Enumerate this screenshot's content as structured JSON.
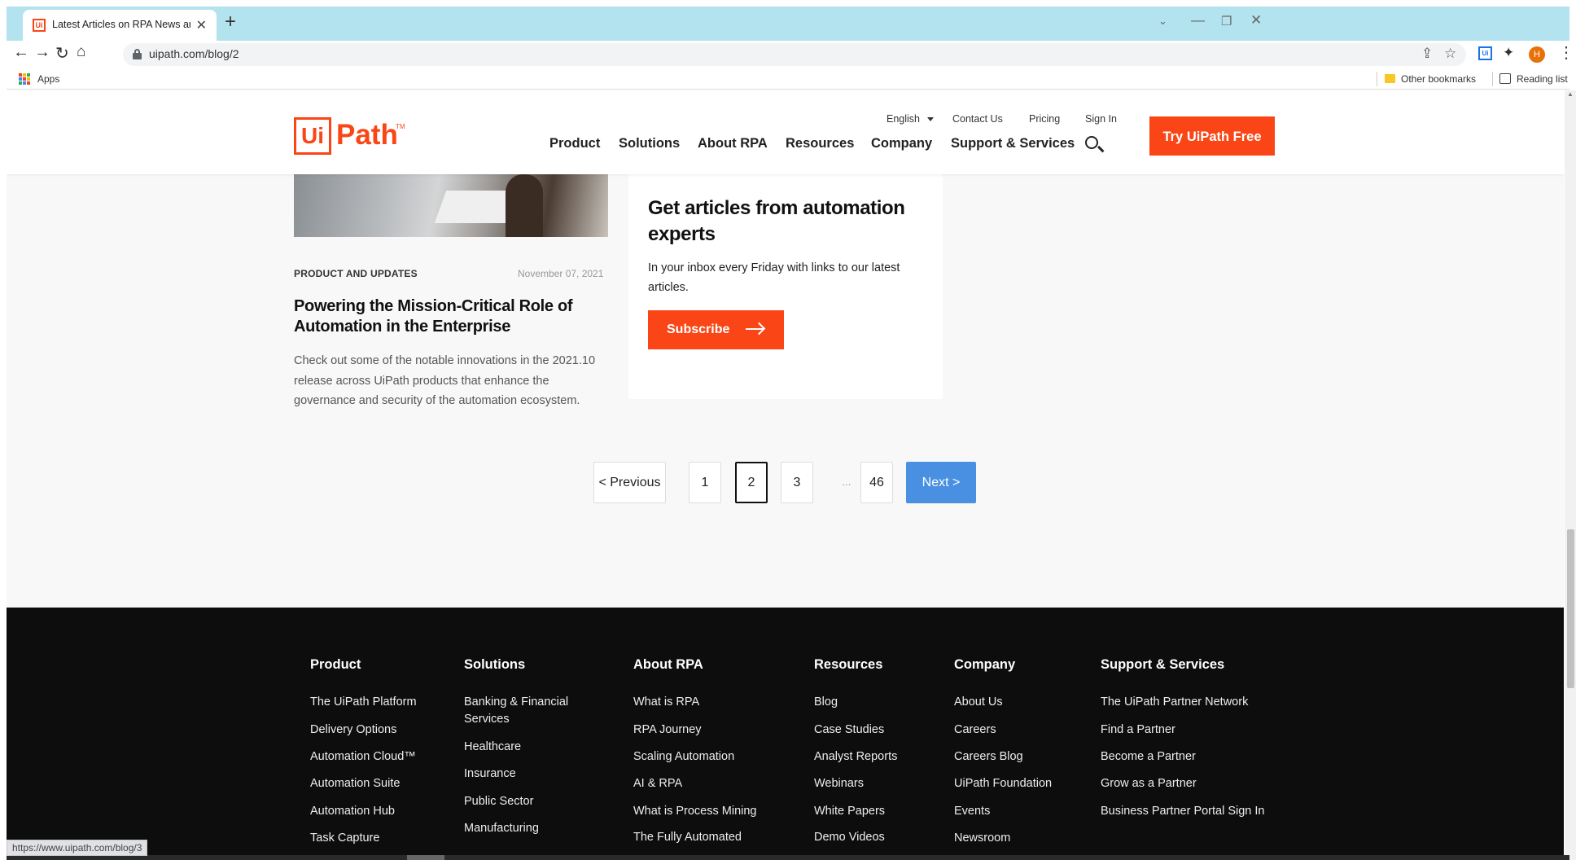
{
  "browser": {
    "tab": {
      "title": "Latest Articles on RPA News and",
      "favicon": "uipath-favicon-icon"
    },
    "url": "uipath.com/blog/2",
    "bookmarks": {
      "apps": "Apps",
      "other": "Other bookmarks",
      "reading": "Reading list"
    },
    "profile_initial": "H",
    "status_url": "https://www.uipath.com/blog/3"
  },
  "header": {
    "logo_box": "Ui",
    "logo_text": "Path",
    "logo_tm": "TM",
    "utility": {
      "language": "English",
      "contact": "Contact Us",
      "pricing": "Pricing",
      "signin": "Sign In"
    },
    "nav": [
      "Product",
      "Solutions",
      "About RPA",
      "Resources",
      "Company",
      "Support & Services"
    ],
    "cta": "Try UiPath Free"
  },
  "article": {
    "category": "PRODUCT AND UPDATES",
    "date": "November 07, 2021",
    "title": "Powering the Mission-Critical Role of Automation in the Enterprise",
    "excerpt": "Check out some of the notable innovations in the 2021.10 release across UiPath products that enhance the governance and security of the automation ecosystem."
  },
  "subscribe": {
    "title": "Get articles from automation experts",
    "description": "In your inbox every Friday with links to our latest articles.",
    "button": "Subscribe"
  },
  "pagination": {
    "previous": "<  Previous",
    "pages": [
      "1",
      "2",
      "3"
    ],
    "ellipsis": "...",
    "last": "46",
    "next": "Next  >",
    "current": "2"
  },
  "footer": {
    "columns": [
      {
        "heading": "Product",
        "links": [
          "The UiPath Platform",
          "Delivery Options",
          "Automation Cloud™",
          "Automation Suite",
          "Automation Hub",
          "Task Capture"
        ]
      },
      {
        "heading": "Solutions",
        "links": [
          "Banking & Financial Services",
          "Healthcare",
          "Insurance",
          "Public Sector",
          "Manufacturing"
        ]
      },
      {
        "heading": "About RPA",
        "links": [
          "What is RPA",
          "RPA Journey",
          "Scaling Automation",
          "AI & RPA",
          "What is Process Mining",
          "The Fully Automated"
        ]
      },
      {
        "heading": "Resources",
        "links": [
          "Blog",
          "Case Studies",
          "Analyst Reports",
          "Webinars",
          "White Papers",
          "Demo Videos"
        ]
      },
      {
        "heading": "Company",
        "links": [
          "About Us",
          "Careers",
          "Careers Blog",
          "UiPath Foundation",
          "Events",
          "Newsroom"
        ]
      },
      {
        "heading": "Support & Services",
        "links": [
          "The UiPath Partner Network",
          "Find a Partner",
          "Become a Partner",
          "Grow as a Partner",
          "Business Partner Portal Sign In"
        ]
      }
    ]
  },
  "colors": {
    "brand": "#fa4616",
    "pager_next": "#4a90e2",
    "footer_bg": "#0d0d0d",
    "tabstrip": "#b3e3ee"
  }
}
